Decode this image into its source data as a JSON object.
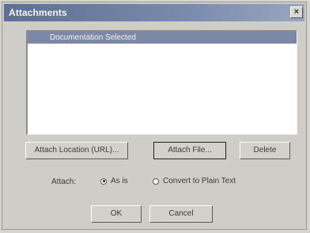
{
  "window": {
    "title": "Attachments",
    "close_glyph": "×"
  },
  "attachments_list": {
    "items": [
      {
        "label": "Documentation Selected",
        "selected": true
      }
    ]
  },
  "buttons": {
    "attach_location": "Attach Location (URL)...",
    "attach_file": "Attach File...",
    "delete": "Delete",
    "ok": "OK",
    "cancel": "Cancel"
  },
  "attach_options": {
    "label": "Attach:",
    "as_is": "As is",
    "convert_plain_text": "Convert to Plain Text",
    "selected": "as_is"
  },
  "colors": {
    "titlebar_start": "#5d6f93",
    "selection": "#7d87a6",
    "dialog_face": "#cfcdc8"
  }
}
